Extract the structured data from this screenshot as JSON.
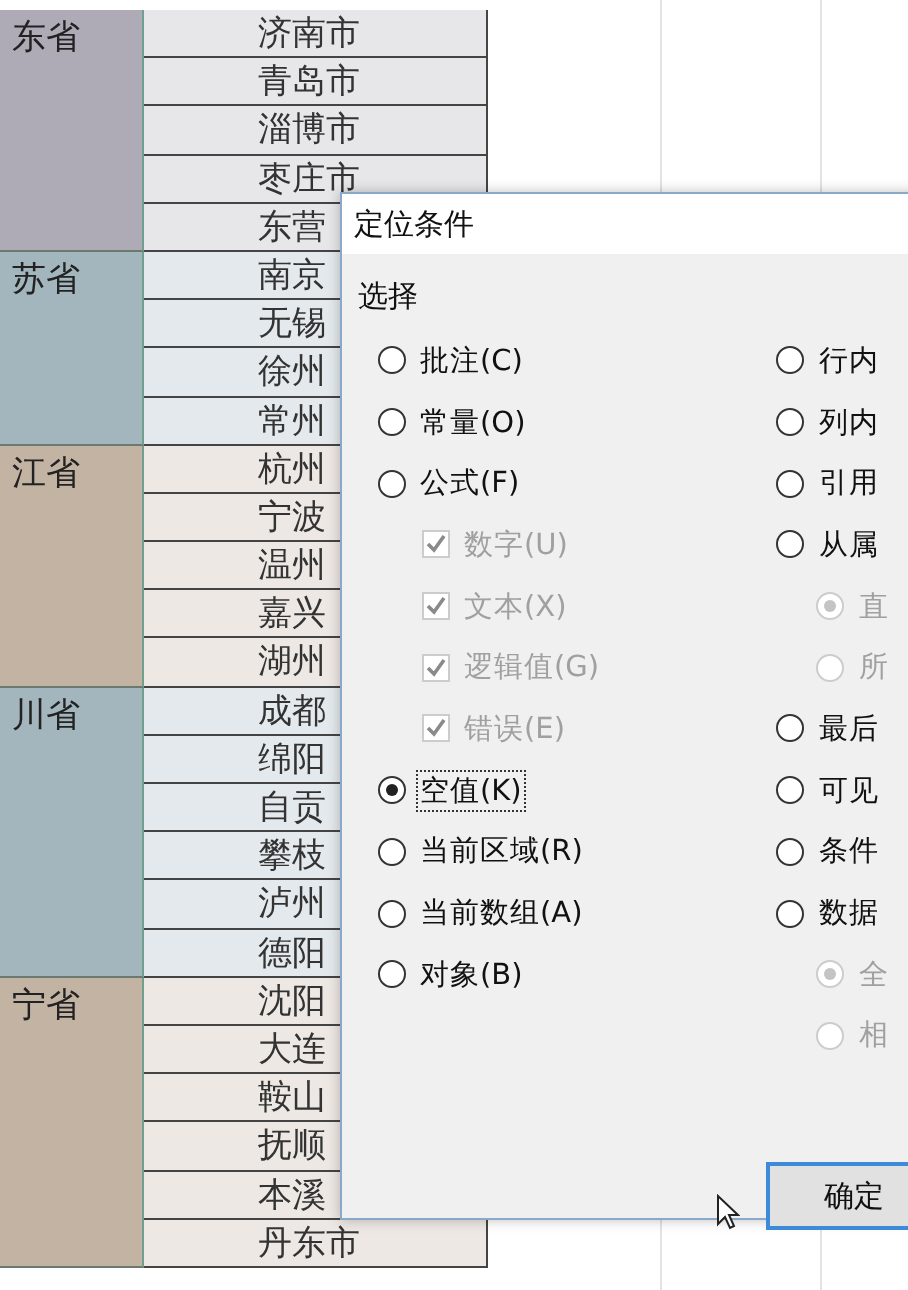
{
  "sheet": {
    "groups": [
      {
        "province": "东省",
        "color": "#aeaab6",
        "cities": [
          "济南市",
          "青岛市",
          "淄博市",
          "枣庄市",
          "东营"
        ]
      },
      {
        "province": "苏省",
        "color": "#a3b6be",
        "cities": [
          "南京",
          "无锡",
          "徐州",
          "常州"
        ]
      },
      {
        "province": "江省",
        "color": "#c2b3a3",
        "cities": [
          "杭州",
          "宁波",
          "温州",
          "嘉兴",
          "湖州"
        ]
      },
      {
        "province": "川省",
        "color": "#a3b6be",
        "cities": [
          "成都",
          "绵阳",
          "自贡",
          "攀枝",
          "泸州",
          "德阳"
        ]
      },
      {
        "province": "宁省",
        "color": "#c2b3a3",
        "cities": [
          "沈阳",
          "大连",
          "鞍山",
          "抚顺",
          "本溪",
          "丹东市"
        ]
      }
    ]
  },
  "dialog": {
    "title": "定位条件",
    "group_label": "选择",
    "left_options": [
      {
        "kind": "radio",
        "label": "批注(C)",
        "selected": false,
        "disabled": false
      },
      {
        "kind": "radio",
        "label": "常量(O)",
        "selected": false,
        "disabled": false
      },
      {
        "kind": "radio",
        "label": "公式(F)",
        "selected": false,
        "disabled": false
      },
      {
        "kind": "checkbox",
        "label": "数字(U)",
        "checked": true,
        "disabled": true
      },
      {
        "kind": "checkbox",
        "label": "文本(X)",
        "checked": true,
        "disabled": true
      },
      {
        "kind": "checkbox",
        "label": "逻辑值(G)",
        "checked": true,
        "disabled": true
      },
      {
        "kind": "checkbox",
        "label": "错误(E)",
        "checked": true,
        "disabled": true
      },
      {
        "kind": "radio",
        "label": "空值(K)",
        "selected": true,
        "disabled": false
      },
      {
        "kind": "radio",
        "label": "当前区域(R)",
        "selected": false,
        "disabled": false
      },
      {
        "kind": "radio",
        "label": "当前数组(A)",
        "selected": false,
        "disabled": false
      },
      {
        "kind": "radio",
        "label": "对象(B)",
        "selected": false,
        "disabled": false
      }
    ],
    "right_options": [
      {
        "kind": "radio",
        "label": "行内",
        "selected": false,
        "disabled": false
      },
      {
        "kind": "radio",
        "label": "列内",
        "selected": false,
        "disabled": false
      },
      {
        "kind": "radio",
        "label": "引用",
        "selected": false,
        "disabled": false
      },
      {
        "kind": "radio",
        "label": "从属",
        "selected": false,
        "disabled": false
      },
      {
        "kind": "subradio",
        "label": "直",
        "selected": true,
        "disabled": true
      },
      {
        "kind": "subradio",
        "label": "所",
        "selected": false,
        "disabled": true
      },
      {
        "kind": "radio",
        "label": "最后",
        "selected": false,
        "disabled": false
      },
      {
        "kind": "radio",
        "label": "可见",
        "selected": false,
        "disabled": false
      },
      {
        "kind": "radio",
        "label": "条件",
        "selected": false,
        "disabled": false
      },
      {
        "kind": "radio",
        "label": "数据",
        "selected": false,
        "disabled": false
      },
      {
        "kind": "subradio",
        "label": "全",
        "selected": true,
        "disabled": true
      },
      {
        "kind": "subradio",
        "label": "相",
        "selected": false,
        "disabled": true
      }
    ],
    "ok_button": "确定"
  }
}
